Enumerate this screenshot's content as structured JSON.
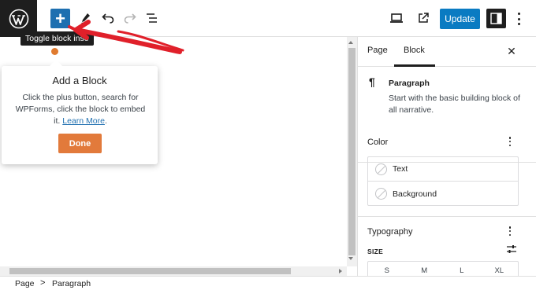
{
  "toolbar": {
    "tooltip": "Toggle block inse",
    "update_label": "Update",
    "add_icon": "+"
  },
  "popover": {
    "title": "Add a Block",
    "body": "Click the plus button, search for WPForms, click the block to embed it.",
    "link": "Learn More",
    "link_suffix": ".",
    "done_label": "Done"
  },
  "sidebar": {
    "tabs": [
      {
        "label": "Page"
      },
      {
        "label": "Block"
      }
    ],
    "close_icon": "✕",
    "block": {
      "icon": "¶",
      "name": "Paragraph",
      "description": "Start with the basic building block of all narrative."
    },
    "color": {
      "title": "Color",
      "items": [
        {
          "label": "Text"
        },
        {
          "label": "Background"
        }
      ]
    },
    "typography": {
      "title": "Typography",
      "size_label": "SIZE",
      "sizes": [
        "S",
        "M",
        "L",
        "XL"
      ]
    }
  },
  "breadcrumb": {
    "items": [
      "Page",
      "Paragraph"
    ],
    "separator": ">"
  },
  "colors": {
    "accent": "#1d6fb0",
    "update": "#0a7bc2",
    "done": "#e27a3b",
    "annotation": "#e0202a"
  }
}
